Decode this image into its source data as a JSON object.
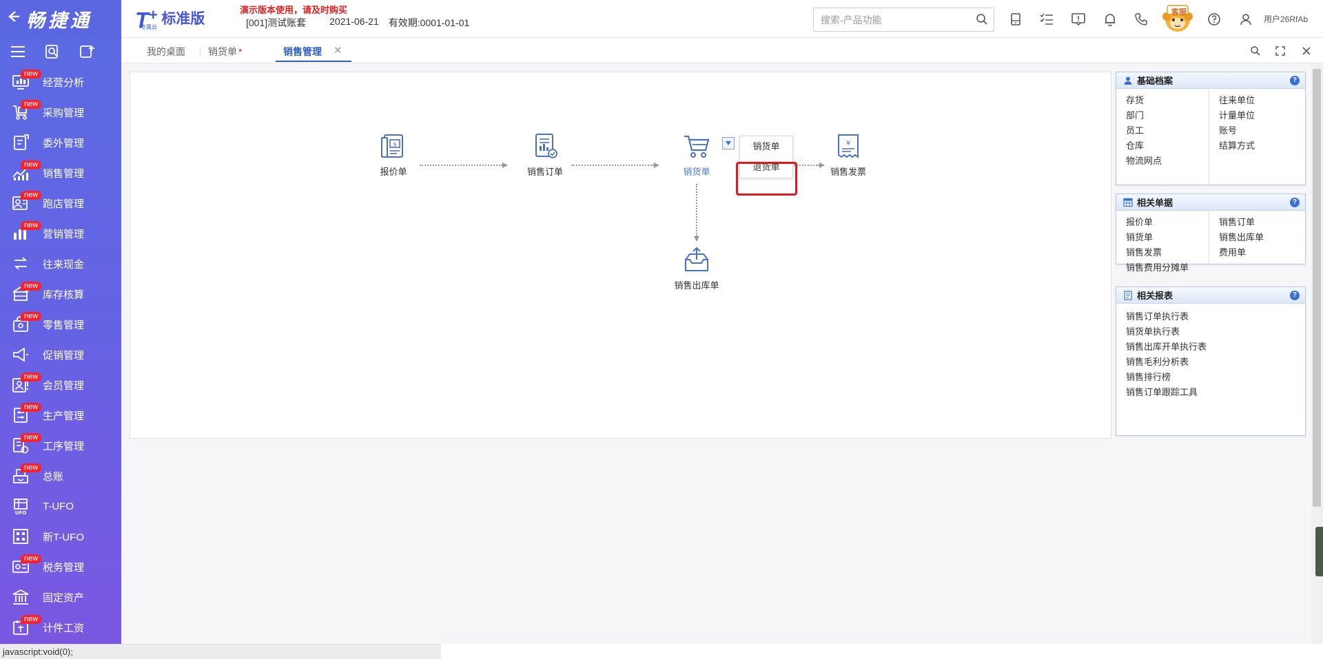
{
  "brand": {
    "name": "畅捷通",
    "back_icon": "arrow-left-icon"
  },
  "logo": {
    "product": "T",
    "plus": "+",
    "sub": "专属云",
    "edition": "标准版"
  },
  "header": {
    "demo_warning": "演示版本使用，请及时购买",
    "account": "[001]测试账套",
    "date": "2021-06-21",
    "valid_until": "有效期:0001-01-01",
    "search_placeholder": "搜索-产品功能",
    "cs_label": "客服",
    "user": "用户26RfAb"
  },
  "sidebar": {
    "tools": [
      "menu-icon",
      "search-doc-icon",
      "add-doc-icon"
    ],
    "new_badge": "new",
    "items": [
      {
        "label": "经营分析",
        "icon": "analysis-icon",
        "new": true
      },
      {
        "label": "采购管理",
        "icon": "purchase-icon",
        "new": true
      },
      {
        "label": "委外管理",
        "icon": "outsource-icon",
        "new": false
      },
      {
        "label": "销售管理",
        "icon": "sales-icon",
        "new": true
      },
      {
        "label": "跑店管理",
        "icon": "store-visit-icon",
        "new": true
      },
      {
        "label": "营销管理",
        "icon": "marketing-icon",
        "new": true
      },
      {
        "label": "往来现金",
        "icon": "cash-flow-icon",
        "new": false
      },
      {
        "label": "库存核算",
        "icon": "inventory-icon",
        "new": true
      },
      {
        "label": "零售管理",
        "icon": "retail-icon",
        "new": true
      },
      {
        "label": "促销管理",
        "icon": "promotion-icon",
        "new": false
      },
      {
        "label": "会员管理",
        "icon": "member-icon",
        "new": true
      },
      {
        "label": "生产管理",
        "icon": "production-icon",
        "new": true
      },
      {
        "label": "工序管理",
        "icon": "process-icon",
        "new": true
      },
      {
        "label": "总账",
        "icon": "ledger-icon",
        "new": true
      },
      {
        "label": "T-UFO",
        "icon": "ufo-icon",
        "new": false
      },
      {
        "label": "新T-UFO",
        "icon": "new-ufo-icon",
        "new": false
      },
      {
        "label": "税务管理",
        "icon": "tax-icon",
        "new": true
      },
      {
        "label": "固定资产",
        "icon": "fixed-asset-icon",
        "new": false
      },
      {
        "label": "计件工资",
        "icon": "piece-wage-icon",
        "new": true
      }
    ]
  },
  "tabs": {
    "desktop": "我的桌面",
    "sales_doc": "销货单",
    "sales_doc_dirty": "*",
    "sales_mgmt": "销售管理"
  },
  "flow": {
    "quote": "报价单",
    "order": "销售订单",
    "delivery": "销货单",
    "invoice": "销售发票",
    "outbound": "销售出库单",
    "dropdown": [
      "销货单",
      "退货单"
    ]
  },
  "panels": {
    "basic": {
      "title": "基础档案",
      "left": [
        "存货",
        "部门",
        "员工",
        "仓库",
        "物流网点"
      ],
      "right": [
        "往来单位",
        "计量单位",
        "账号",
        "结算方式"
      ]
    },
    "docs": {
      "title": "相关单据",
      "left": [
        "报价单",
        "销货单",
        "销售发票",
        "销售费用分摊单"
      ],
      "right": [
        "销售订单",
        "销售出库单",
        "费用单"
      ]
    },
    "reports": {
      "title": "相关报表",
      "items": [
        "销售订单执行表",
        "销货单执行表",
        "销售出库开单执行表",
        "销售毛利分析表",
        "销售排行榜",
        "销售订单跟踪工具"
      ]
    }
  },
  "status_bar": "javascript:void(0);",
  "colors": {
    "sidebar_top": "#5b6ae3",
    "sidebar_bottom": "#7a57e1",
    "accent": "#2c5ec8",
    "warning": "#e02020",
    "badge": "#f5222d"
  }
}
